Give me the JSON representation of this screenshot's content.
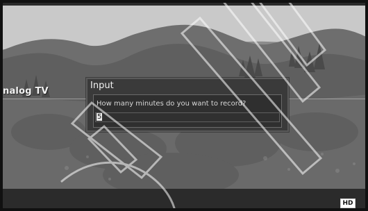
{
  "channel": {
    "label": "nalog TV"
  },
  "dialog": {
    "title": "Input",
    "prompt": "How many minutes do you want to record?",
    "input_value": "5"
  },
  "status": {
    "badge": "HD"
  }
}
